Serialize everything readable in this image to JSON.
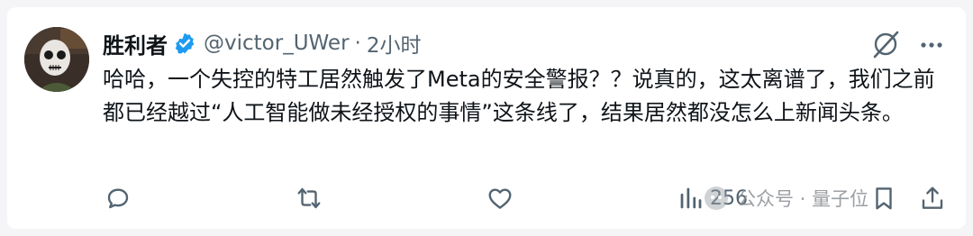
{
  "tweet": {
    "author_name": "胜利者",
    "handle": "@victor_UWer",
    "separator": "·",
    "time": "2小时",
    "text": "哈哈，一个失控的特工居然触发了Meta的安全警报？？说真的，这太离谱了，我们之前都已经越过“人工智能做未经授权的事情”这条线了，结果居然都没怎么上新闻头条。"
  },
  "actions": {
    "reply_icon": "reply-icon",
    "retweet_icon": "retweet-icon",
    "like_icon": "heart-icon",
    "views_icon": "views-chart-icon",
    "views_count": "256",
    "bookmark_icon": "bookmark-icon",
    "share_icon": "share-icon"
  },
  "watermark": {
    "text": "公众号 · 量子位"
  },
  "colors": {
    "text": "#0f1419",
    "secondary": "#536471",
    "verified": "#1d9bf0",
    "background": "#f5f5f7"
  }
}
